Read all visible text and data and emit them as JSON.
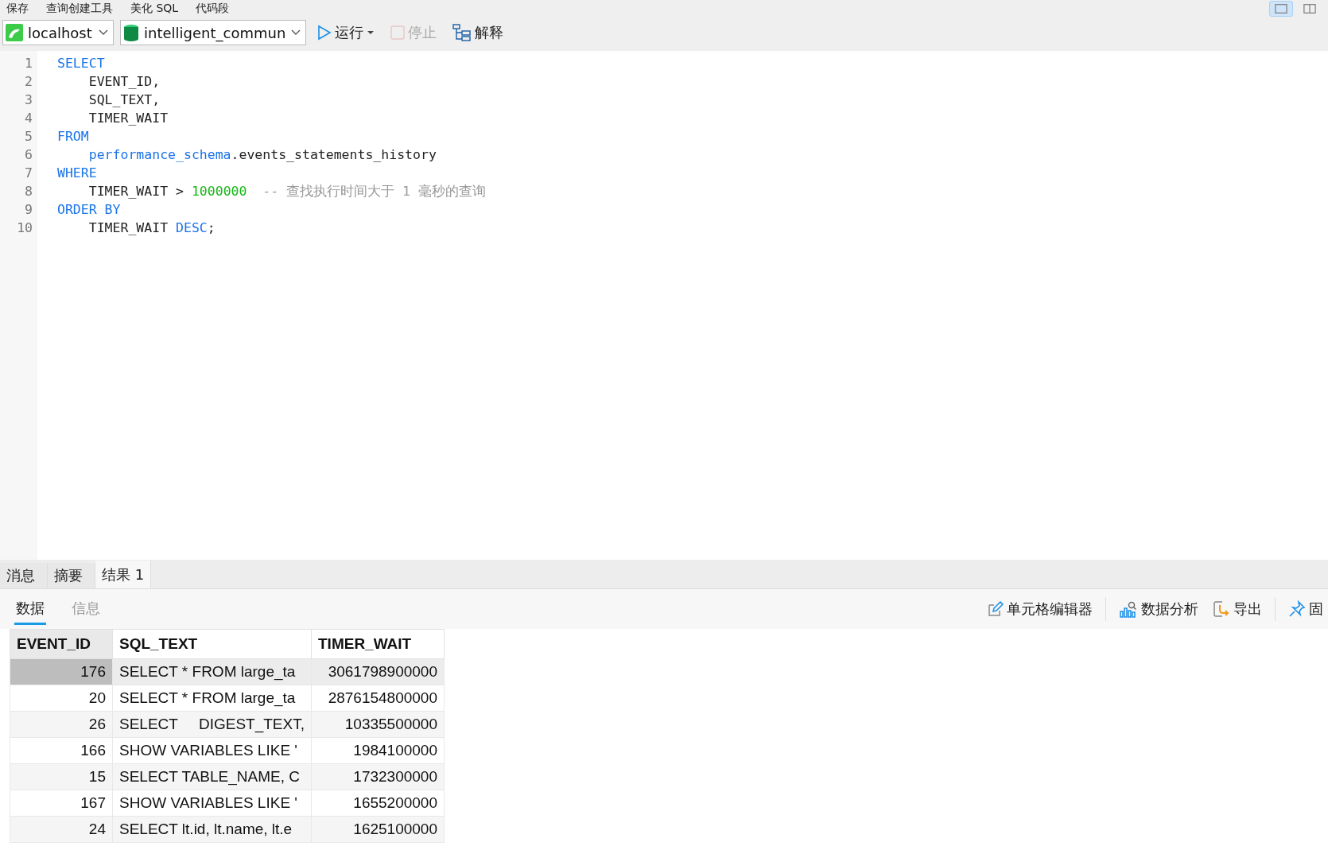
{
  "top_toolbar": {
    "items": [
      "保存",
      "查询创建工具",
      "美化 SQL",
      "代码段"
    ]
  },
  "view_toggle": [
    {
      "selected": true
    },
    {
      "selected": false
    }
  ],
  "query_toolbar": {
    "connection": "localhost",
    "database": "intelligent_commun",
    "run": "运行",
    "stop": "停止",
    "stop_disabled": true,
    "explain": "解释"
  },
  "editor": {
    "lines": [
      [
        {
          "kind": "keyword",
          "text": "SELECT"
        }
      ],
      [
        {
          "kind": "plain",
          "text": "    EVENT_ID,"
        }
      ],
      [
        {
          "kind": "plain",
          "text": "    SQL_TEXT,"
        }
      ],
      [
        {
          "kind": "plain",
          "text": "    TIMER_WAIT"
        }
      ],
      [
        {
          "kind": "keyword",
          "text": "FROM"
        }
      ],
      [
        {
          "kind": "keyword",
          "text": "    performance_schema"
        },
        {
          "kind": "plain",
          "text": ".events_statements_history"
        }
      ],
      [
        {
          "kind": "keyword",
          "text": "WHERE"
        }
      ],
      [
        {
          "kind": "plain",
          "text": "    TIMER_WAIT > "
        },
        {
          "kind": "number",
          "text": "1000000"
        },
        {
          "kind": "comment",
          "text": "  -- 查找执行时间大于 1 毫秒的查询"
        }
      ],
      [
        {
          "kind": "keyword",
          "text": "ORDER BY"
        }
      ],
      [
        {
          "kind": "plain",
          "text": "    TIMER_WAIT "
        },
        {
          "kind": "keyword",
          "text": "DESC"
        },
        {
          "kind": "plain",
          "text": ";"
        }
      ]
    ],
    "line_numbers": [
      "1",
      "2",
      "3",
      "4",
      "5",
      "6",
      "7",
      "8",
      "9",
      "10"
    ]
  },
  "result_tabs": [
    {
      "label": "消息",
      "selected": false
    },
    {
      "label": "摘要",
      "selected": false
    },
    {
      "label": "结果 1",
      "selected": true
    }
  ],
  "sub_tabs": [
    {
      "label": "数据",
      "selected": true
    },
    {
      "label": "信息",
      "selected": false
    }
  ],
  "result_actions": [
    {
      "kind": "edit",
      "label": "单元格编辑器"
    },
    {
      "kind": "analyze",
      "label": "数据分析"
    },
    {
      "kind": "export",
      "label": "导出"
    },
    {
      "kind": "pin",
      "label": "固"
    }
  ],
  "table": {
    "columns": [
      "EVENT_ID",
      "SQL_TEXT",
      "TIMER_WAIT"
    ],
    "rows": [
      {
        "cells": [
          "176",
          "SELECT * FROM large_ta",
          "3061798900000"
        ],
        "selected": true
      },
      {
        "cells": [
          "20",
          "SELECT * FROM large_ta",
          "2876154800000"
        ],
        "selected": false
      },
      {
        "cells": [
          "26",
          "SELECT     DIGEST_TEXT,",
          "10335500000"
        ],
        "selected": false
      },
      {
        "cells": [
          "166",
          "SHOW VARIABLES LIKE '",
          "1984100000"
        ],
        "selected": false
      },
      {
        "cells": [
          "15",
          "SELECT TABLE_NAME, C",
          "1732300000"
        ],
        "selected": false
      },
      {
        "cells": [
          "167",
          "SHOW VARIABLES LIKE '",
          "1655200000"
        ],
        "selected": false
      },
      {
        "cells": [
          "24",
          "SELECT lt.id, lt.name, lt.e",
          "1625100000"
        ],
        "selected": false
      }
    ]
  }
}
